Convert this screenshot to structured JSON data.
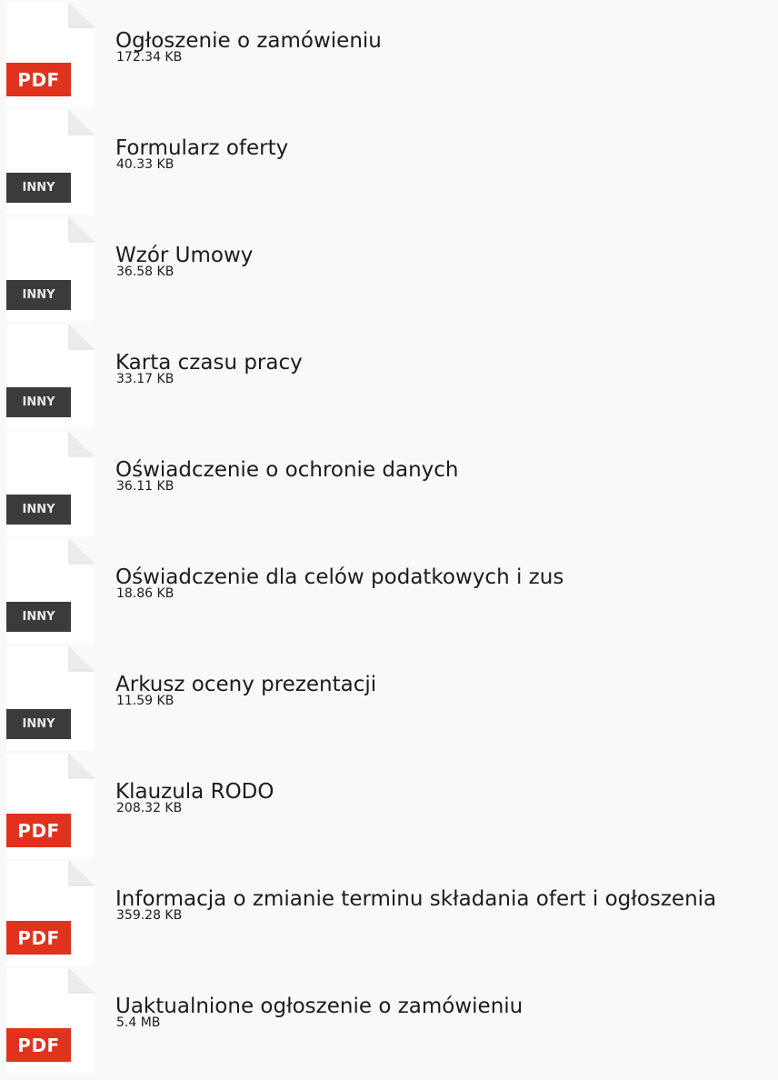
{
  "attachments": [
    {
      "type_label": "PDF",
      "icon": "pdf-file-icon",
      "name": "Ogłoszenie o zamówieniu",
      "size": "172.34 KB"
    },
    {
      "type_label": "INNY",
      "icon": "other-file-icon",
      "name": "Formularz oferty",
      "size": "40.33 KB"
    },
    {
      "type_label": "INNY",
      "icon": "other-file-icon",
      "name": "Wzór Umowy",
      "size": "36.58 KB"
    },
    {
      "type_label": "INNY",
      "icon": "other-file-icon",
      "name": "Karta czasu pracy",
      "size": "33.17 KB"
    },
    {
      "type_label": "INNY",
      "icon": "other-file-icon",
      "name": "Oświadczenie o ochronie danych",
      "size": "36.11 KB"
    },
    {
      "type_label": "INNY",
      "icon": "other-file-icon",
      "name": "Oświadczenie dla celów podatkowych i zus",
      "size": "18.86 KB"
    },
    {
      "type_label": "INNY",
      "icon": "other-file-icon",
      "name": "Arkusz oceny prezentacji",
      "size": "11.59 KB"
    },
    {
      "type_label": "PDF",
      "icon": "pdf-file-icon",
      "name": "Klauzula RODO",
      "size": "208.32 KB"
    },
    {
      "type_label": "PDF",
      "icon": "pdf-file-icon",
      "name": "Informacja o zmianie terminu składania ofert i ogłoszenia",
      "size": "359.28 KB"
    },
    {
      "type_label": "PDF",
      "icon": "pdf-file-icon",
      "name": "Uaktualnione ogłoszenie o zamówieniu",
      "size": "5.4 MB"
    }
  ],
  "colors": {
    "pdf_badge": "#e0321c",
    "other_badge": "#3b3b3b",
    "page_background": "#f9f9f9"
  }
}
